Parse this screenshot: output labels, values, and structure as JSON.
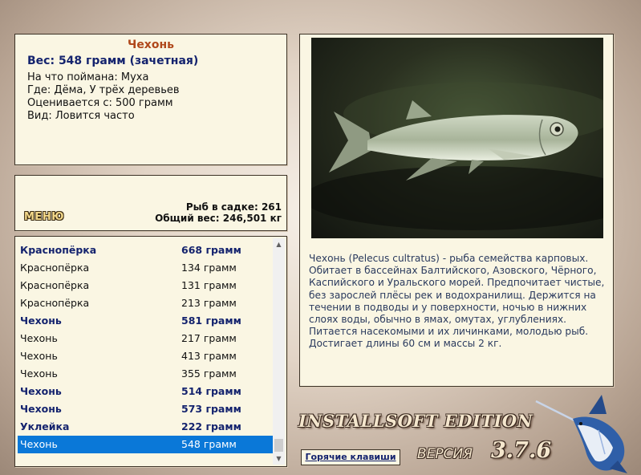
{
  "info": {
    "fish_name": "Чехонь",
    "weight_line": "Вес: 548 грамм (зачетная)",
    "caught_on": "На что поймана: Муха",
    "location": "Где: Дёма, У трёх деревьев",
    "valued_from": "Оценивается с: 500 грамм",
    "kind": "Вид: Ловится часто"
  },
  "stats": {
    "menu_label": "МЕНЮ",
    "fish_in_net": "Рыб в садке: 261",
    "total_weight": "Общий вес: 246,501 кг"
  },
  "catch_list": [
    {
      "name": "Краснопёрка",
      "weight": "668 грамм",
      "style": "hl"
    },
    {
      "name": "Краснопёрка",
      "weight": "134 грамм",
      "style": "normal"
    },
    {
      "name": "Краснопёрка",
      "weight": "131 грамм",
      "style": "normal"
    },
    {
      "name": "Краснопёрка",
      "weight": "213 грамм",
      "style": "normal"
    },
    {
      "name": "Чехонь",
      "weight": "581 грамм",
      "style": "hl"
    },
    {
      "name": "Чехонь",
      "weight": "217 грамм",
      "style": "normal"
    },
    {
      "name": "Чехонь",
      "weight": "413 грамм",
      "style": "normal"
    },
    {
      "name": "Чехонь",
      "weight": "355 грамм",
      "style": "normal"
    },
    {
      "name": "Чехонь",
      "weight": "514 грамм",
      "style": "hl"
    },
    {
      "name": "Чехонь",
      "weight": "573 грамм",
      "style": "hl"
    },
    {
      "name": "Уклейка",
      "weight": "222 грамм",
      "style": "hl"
    },
    {
      "name": "Чехонь",
      "weight": "548 грамм",
      "style": "sel"
    }
  ],
  "description": "Чехонь (Pelecus cultratus) - рыба семейства карповых. Обитает в бассейнах Балтийского, Азовского, Чёрного, Каспийского и Уральского морей. Предпочитает чистые, без зарослей плёсы рек и водохранилищ. Держится на течении в подводы и у поверхности, ночью в нижних слоях воды, обычно в ямах, омутах, углублениях. Питается насекомыми и их личинками, молодью рыб. Достигает длины 60 см и массы 2 кг.",
  "branding": {
    "edition": "INSTALLSOFT EDITION",
    "version_label": "ВЕРСИЯ",
    "version_number": "3.7.6",
    "hotkeys_label": "Горячие клавиши"
  },
  "icons": {
    "scroll_up": "scroll-up-arrow-icon",
    "scroll_down": "scroll-down-arrow-icon",
    "fish_photo": "sabrefish-photo",
    "logo": "marlin-logo-icon"
  },
  "colors": {
    "panel_bg": "#faf6e3",
    "title_orange": "#b0481b",
    "navy": "#14236e",
    "selection_blue": "#0a78d8"
  }
}
